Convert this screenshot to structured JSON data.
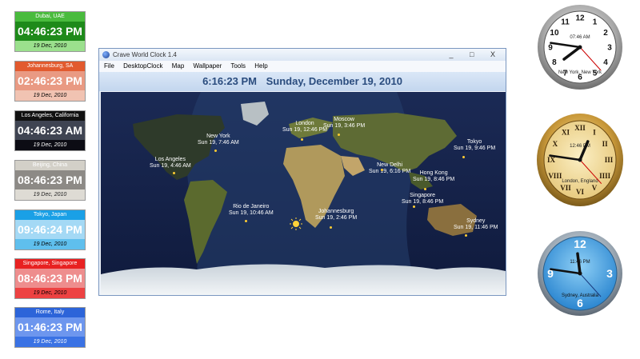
{
  "widgets": [
    {
      "city": "Dubai, UAE",
      "time": "04:46:23 PM",
      "date": "19 Dec, 2010",
      "header": "#49bb3d",
      "body": "#1e8a1a",
      "footer": "#9be08d",
      "text": "#000000"
    },
    {
      "city": "Johannesburg, SA",
      "time": "02:46:23 PM",
      "date": "19 Dec, 2010",
      "header": "#e25a2e",
      "body": "#e99a83",
      "footer": "#f1c3b2",
      "text": "#000000"
    },
    {
      "city": "Los Angeles, California",
      "time": "04:46:23 AM",
      "date": "19 Dec, 2010",
      "header": "#111111",
      "body": "#3f4452",
      "footer": "#0c0c14",
      "text": "#ffffff"
    },
    {
      "city": "Beijing, China",
      "time": "08:46:23 PM",
      "date": "19 Dec, 2010",
      "header": "#d3d0c8",
      "body": "#8d8a86",
      "footer": "#dedbd4",
      "text": "#222222"
    },
    {
      "city": "Tokyo, Japan",
      "time": "09:46:24 PM",
      "date": "19 Dec, 2010",
      "header": "#1aa0e6",
      "body": "#a4d9f5",
      "footer": "#5fbfed",
      "text": "#000000"
    },
    {
      "city": "Singapore, Singapore",
      "time": "08:46:23 PM",
      "date": "19 Dec, 2010",
      "header": "#e82121",
      "body": "#ee8d8d",
      "footer": "#ed4242",
      "text": "#000000"
    },
    {
      "city": "Rome, Italy",
      "time": "01:46:23 PM",
      "date": "19 Dec, 2010",
      "header": "#2c64d9",
      "body": "#6d96ee",
      "footer": "#3a72e4",
      "text": "#ffffff"
    }
  ],
  "window": {
    "title": "Crave World Clock 1.4",
    "buttons": "_ □ X",
    "menu": [
      "File",
      "DesktopClock",
      "Map",
      "Wallpaper",
      "Tools",
      "Help"
    ],
    "time": "6:16:23 PM",
    "date": "Sunday, December 19, 2010"
  },
  "map_labels": [
    {
      "city": "London",
      "time": "Sun 19, 12:46 PM"
    },
    {
      "city": "Moscow",
      "time": "Sun 19, 3:46 PM"
    },
    {
      "city": "New York",
      "time": "Sun 19, 7:46 AM"
    },
    {
      "city": "Tokyo",
      "time": "Sun 19, 9:46 PM"
    },
    {
      "city": "Los Angeles",
      "time": "Sun 19, 4:46 AM"
    },
    {
      "city": "New Delhi",
      "time": "Sun 19, 6:16 PM"
    },
    {
      "city": "Hong Kong",
      "time": "Sun 19, 8:46 PM"
    },
    {
      "city": "Singapore",
      "time": "Sun 19, 8:46 PM"
    },
    {
      "city": "Rio de Janeiro",
      "time": "Sun 19, 10:46 AM"
    },
    {
      "city": "Johannesburg",
      "time": "Sun 19, 2:46 PM"
    },
    {
      "city": "Sydney",
      "time": "Sun 19, 11:46 PM"
    }
  ],
  "analog_clocks": [
    {
      "label": "New York, New York",
      "digital": "07:46 AM",
      "hour": 7,
      "minute": 46,
      "second": 23,
      "numerals": [
        "12",
        "1",
        "2",
        "3",
        "4",
        "5",
        "6",
        "7",
        "8",
        "9",
        "10",
        "11"
      ]
    },
    {
      "label": "London, England",
      "digital": "12:46 PM",
      "hour": 12,
      "minute": 46,
      "second": 23,
      "numerals": [
        "XII",
        "I",
        "II",
        "III",
        "IIII",
        "V",
        "VI",
        "VII",
        "VIII",
        "IX",
        "X",
        "XI"
      ]
    },
    {
      "label": "Sydney, Australia",
      "digital": "11:46 PM",
      "hour": 11,
      "minute": 46,
      "second": 23,
      "numerals": [
        "12",
        "",
        "",
        "3",
        "",
        "",
        "6",
        "",
        "",
        "9",
        "",
        ""
      ]
    }
  ]
}
